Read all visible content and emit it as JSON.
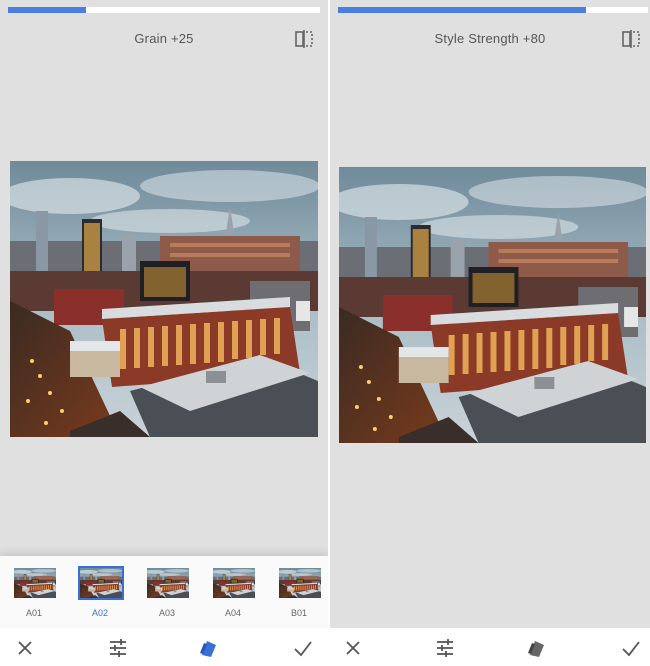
{
  "left_panel": {
    "parameter_label": "Grain +25",
    "progress_fraction": 0.25,
    "filters": [
      {
        "label": "A01"
      },
      {
        "label": "A02"
      },
      {
        "label": "A03"
      },
      {
        "label": "A04"
      },
      {
        "label": "B01"
      }
    ],
    "selected_filter": "A02",
    "toolbar": {
      "cancel_icon": "close-icon",
      "adjust_icon": "sliders-icon",
      "style_icon": "style-icon",
      "apply_icon": "check-icon"
    }
  },
  "right_panel": {
    "parameter_label": "Style Strength +80",
    "progress_fraction": 0.8,
    "toolbar": {
      "cancel_icon": "close-icon",
      "adjust_icon": "sliders-icon",
      "style_icon": "style-icon",
      "apply_icon": "check-icon"
    }
  },
  "colors": {
    "accent": "#4a7fe0",
    "selected": "#3b6fd8",
    "background": "#e0e0e0"
  }
}
